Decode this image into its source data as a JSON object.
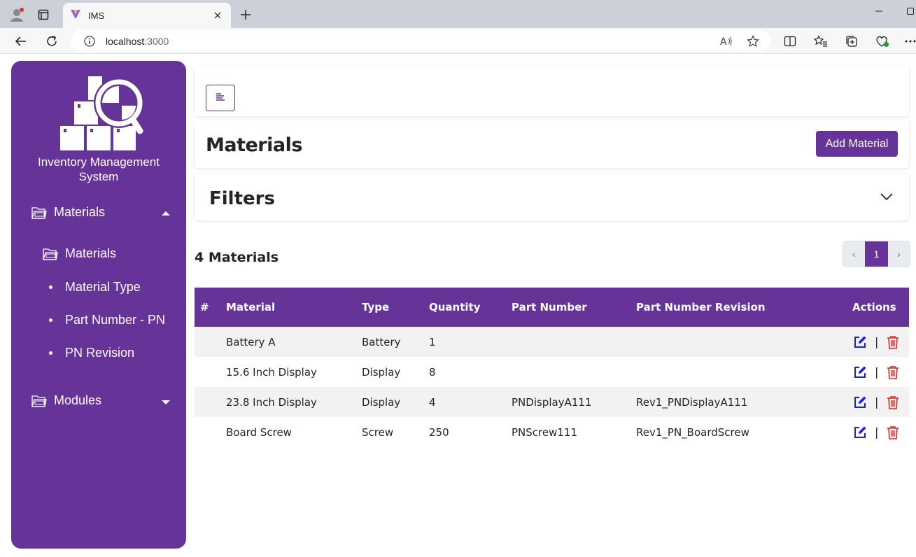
{
  "browser": {
    "tab_title": "IMS",
    "url_host": "localhost",
    "url_port": ":3000"
  },
  "sidebar": {
    "app_name_line1": "Inventory Management",
    "app_name_line2": "System",
    "sections": [
      {
        "label": "Materials",
        "expanded": true,
        "items": [
          {
            "label": "Materials",
            "icon": "folder-icon"
          },
          {
            "label": "Material Type",
            "icon": "bullet"
          },
          {
            "label": "Part Number - PN",
            "icon": "bullet"
          },
          {
            "label": "PN Revision",
            "icon": "bullet"
          }
        ]
      },
      {
        "label": "Modules",
        "expanded": false,
        "items": []
      }
    ]
  },
  "header": {
    "page_title": "Materials",
    "add_button": "Add Material",
    "filters_title": "Filters"
  },
  "list": {
    "count_label": "4 Materials",
    "pagination": {
      "prev": "‹",
      "current": "1",
      "next": "›"
    },
    "columns": [
      "#",
      "Material",
      "Type",
      "Quantity",
      "Part Number",
      "Part Number Revision",
      "Actions"
    ],
    "rows": [
      {
        "num": "",
        "material": "Battery A",
        "type": "Battery",
        "quantity": "1",
        "part_number": "",
        "pn_revision": ""
      },
      {
        "num": "",
        "material": "15.6 Inch Display",
        "type": "Display",
        "quantity": "8",
        "part_number": "",
        "pn_revision": ""
      },
      {
        "num": "",
        "material": "23.8 Inch Display",
        "type": "Display",
        "quantity": "4",
        "part_number": "PNDisplayA111",
        "pn_revision": "Rev1_PNDisplayA111"
      },
      {
        "num": "",
        "material": "Board Screw",
        "type": "Screw",
        "quantity": "250",
        "part_number": "PNScrew111",
        "pn_revision": "Rev1_PN_BoardScrew"
      }
    ],
    "action_separator": "|"
  },
  "colors": {
    "brand": "#663399",
    "edit": "#1a1aff",
    "delete": "#e02424"
  }
}
